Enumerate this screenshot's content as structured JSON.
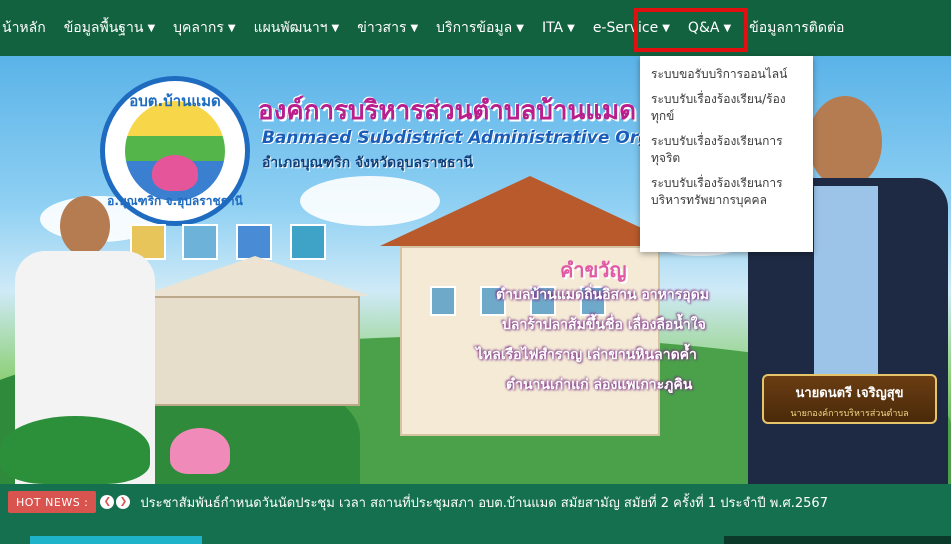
{
  "nav": {
    "items": [
      {
        "label": "น้าหลัก",
        "caret": ""
      },
      {
        "label": "ข้อมูลพื้นฐาน",
        "caret": "▼"
      },
      {
        "label": "บุคลากร",
        "caret": "▼"
      },
      {
        "label": "แผนพัฒนาฯ",
        "caret": "▼"
      },
      {
        "label": "ข่าวสาร",
        "caret": "▼"
      },
      {
        "label": "บริการข้อมูล",
        "caret": "▼"
      },
      {
        "label": "ITA",
        "caret": "▼"
      },
      {
        "label": "e-Service",
        "caret": "▼"
      },
      {
        "label": "Q&A",
        "caret": "▼"
      },
      {
        "label": "ข้อมูลการติดต่อ",
        "caret": ""
      }
    ],
    "highlight_color": "#e01010"
  },
  "eservice_menu": {
    "items": [
      "ระบบขอรับบริการออนไลน์",
      "ระบบรับเรื่องร้องเรียน/ร้องทุกข์",
      "ระบบรับเรื่องร้องเรียนการทุจริต",
      "ระบบรับเรื่องร้องเรียนการบริหารทรัพยากรบุคคล"
    ]
  },
  "banner": {
    "org_name_th": "องค์การบริหารส่วนตำบลบ้านแมด",
    "org_name_en": "Banmaed Subdistrict Administrative Organization",
    "address": "อำเภอบุณฑริก จังหวัดอุบลราชธานี",
    "logo_top": "อบต.บ้านแมด",
    "logo_bottom": "อ.บุณฑริก จ.อุบลราชธานี",
    "slogan_title": "คำขวัญ",
    "slogan_lines": [
      "ตำบลบ้านแมดถิ่นอิสาน อาหารอุดม",
      "ปลาร้าปลาส้มขึ้นชื่อ เลื่องลือน้ำใจ",
      "ไหลเรือไฟสำราญ เล่าขานหินลาดค้ำ",
      "ตำนานเก่าแก่ ล่องแพเกาะภูคิน"
    ],
    "mayor_name": "นายดนตรี เจริญสุข",
    "mayor_title": "นายกองค์การบริหารส่วนตำบล"
  },
  "hot_news": {
    "label": "HOT NEWS :",
    "prev_icon": "❮",
    "next_icon": "❯",
    "text": "ประชาสัมพันธ์กำหนดวันนัดประชุม เวลา สถานที่ประชุมสภา อบต.บ้านแมด สมัยสามัญ สมัยที่ 2 ครั้งที่ 1 ประจำปี พ.ศ.2567"
  },
  "colors": {
    "nav_bg": "#12613f",
    "page_bg": "#15704f",
    "hot_label_bg": "#d9534f",
    "title_pink": "#b91f8c"
  }
}
